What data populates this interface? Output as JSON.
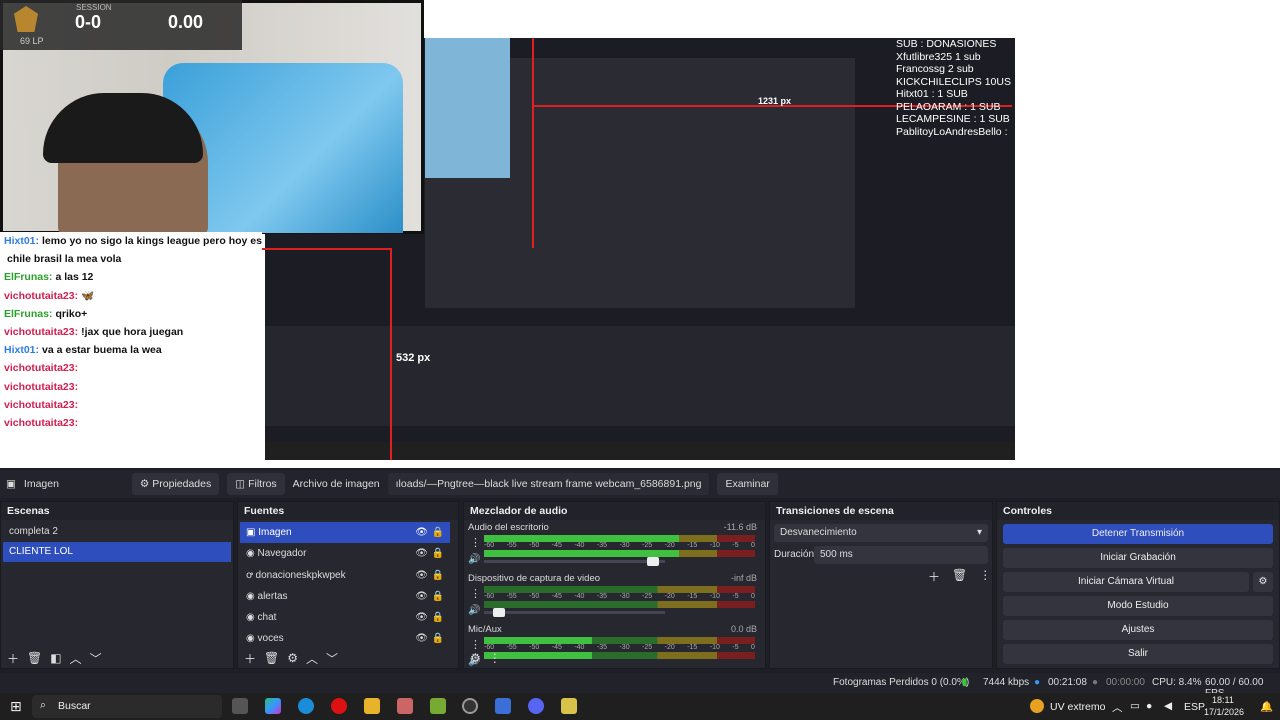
{
  "preview": {
    "score": "0-0",
    "score_value": "0.00",
    "lp": "69 LP",
    "session": "SESSION",
    "chat": [
      {
        "user": "Hixt01:",
        "msg": "lemo yo no sigo la kings league pero hoy es milán",
        "color": "#2e7de0"
      },
      {
        "user": "",
        "msg": "chile brasil la mea vola",
        "color": "#111"
      },
      {
        "user": "ElFrunas:",
        "msg": "a las 12",
        "color": "#2aa02a"
      },
      {
        "user": "vichotutaita23:",
        "msg": "🦋",
        "color": "#d02050"
      },
      {
        "user": "ElFrunas:",
        "msg": "qriko+",
        "color": "#2aa02a"
      },
      {
        "user": "vichotutaita23:",
        "msg": "!jax que hora juegan",
        "color": "#d02050"
      },
      {
        "user": "Hixt01:",
        "msg": "va a estar buema la wea",
        "color": "#2e7de0"
      },
      {
        "user": "vichotutaita23:",
        "msg": "",
        "color": "#d02050"
      },
      {
        "user": "vichotutaita23:",
        "msg": "",
        "color": "#d02050"
      },
      {
        "user": "vichotutaita23:",
        "msg": "",
        "color": "#d02050"
      },
      {
        "user": "vichotutaita23:",
        "msg": "",
        "color": "#d02050"
      }
    ],
    "subs": [
      "SUB : DONASIONES",
      "Xfutlibre325 1 sub",
      "Francossg 2 sub",
      "KICKCHILECLIPS 10US",
      "Hitxt01 : 1 SUB",
      "PELAOARAM : 1 SUB",
      "LECAMPESINE : 1 SUB",
      "PablitoyLoAndresBello :"
    ],
    "subs_mini": [
      "SUB : DONASIONES",
      "Xfutlibre325 1 sub",
      "Francossg 2 sub",
      "KICKCHILECLIPS 10US",
      "Hitxt01 : 1 SUB",
      "PELAOARAM : 1 SUB",
      "LECAMPESINE : 1 SUB",
      "PablitoyLoAndresBello :"
    ],
    "px_label_1": "532 px",
    "px_label_2": "1231 px"
  },
  "source_bar": {
    "source_name": "Imagen",
    "properties": "Propiedades",
    "filters": "Filtros",
    "image_file_label": "Archivo de imagen",
    "image_path": "ıloads/—Pngtree—black live stream frame webcam_6586891.png",
    "browse": "Examinar"
  },
  "scenes": {
    "title": "Escenas",
    "items": [
      "completa 2",
      "CLIENTE LOL"
    ],
    "selected": 1
  },
  "sources": {
    "title": "Fuentes",
    "items": [
      "Imagen",
      "Navegador",
      "donacioneskpkwpek",
      "alertas",
      "chat",
      "voces"
    ],
    "selected": 0
  },
  "mixer": {
    "title": "Mezclador de audio",
    "channels": [
      {
        "name": "Audio del escritorio",
        "db": "-11.6 dB",
        "level": 0.72,
        "volume": 0.9
      },
      {
        "name": "Dispositivo de captura de video",
        "db": "-inf dB",
        "level": 0,
        "volume": 0.05
      },
      {
        "name": "Mic/Aux",
        "db": "0.0 dB",
        "level": 0.4,
        "volume": 0.6
      }
    ],
    "ticks": [
      "-60",
      "-55",
      "-50",
      "-45",
      "-40",
      "-35",
      "-30",
      "-25",
      "-20",
      "-15",
      "-10",
      "-5",
      "0"
    ]
  },
  "transitions": {
    "title": "Transiciones de escena",
    "selected": "Desvanecimiento",
    "duration_label": "Duración",
    "duration_value": "500 ms"
  },
  "controls": {
    "title": "Controles",
    "stop_stream": "Detener Transmisión",
    "start_record": "Iniciar Grabación",
    "virtual_cam": "Iniciar Cámara Virtual",
    "studio_mode": "Modo Estudio",
    "settings": "Ajustes",
    "exit": "Salir"
  },
  "status": {
    "dropped": "Fotogramas Perdidos 0 (0.0%)",
    "kbps": "7444 kbps",
    "stream_time": "00:21:08",
    "record_time": "00:00:00",
    "cpu": "CPU: 8.4%",
    "fps": "60.00 / 60.00 FPS"
  },
  "taskbar": {
    "search": "Buscar",
    "weather": "UV extremo",
    "lang": "ESP",
    "time": "18:11",
    "date": "17/1/2026"
  }
}
